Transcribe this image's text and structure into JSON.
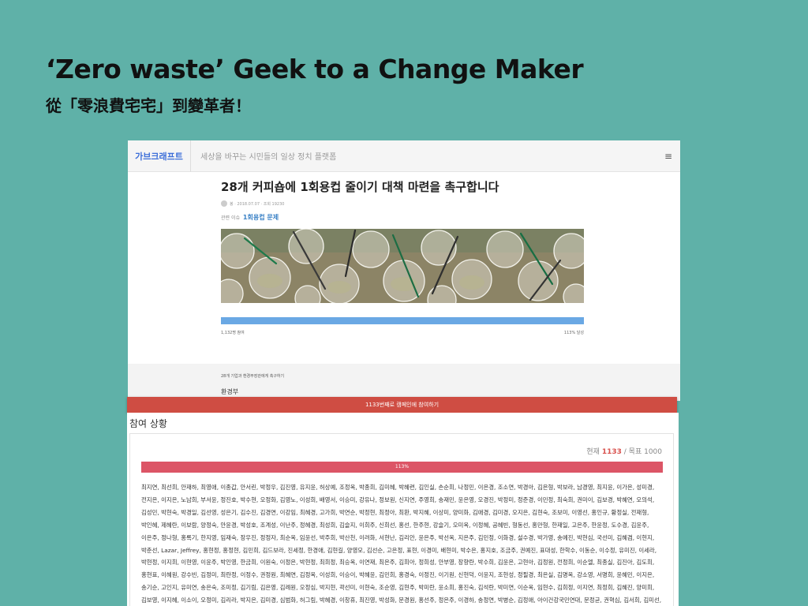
{
  "slide": {
    "title": "‘Zero waste’ Geek to a Change Maker",
    "subtitle": "從「零浪費宅宅」到變革者！"
  },
  "campaign_page": {
    "brand": "가브크래프트",
    "tagline": "세상을 바꾸는 시민들의 일상 정치 플랫폼",
    "menu_icon": "hamburger-icon",
    "post_title": "28개 커피숍에 1회용컵 줄이기 대책 마련을 촉구합니다",
    "meta": "봉 · 2018.07.07 · 조회 19230",
    "issue_label": "관련 이슈",
    "issue_link": "1회용컵 문제",
    "photo_alt": "plastic cups",
    "progress_fraction": 1.0,
    "participants_text": "1,132명 참여",
    "achievement_text": "113% 달성",
    "target_label": "28개 기업과 환경부장관에게 촉구하기",
    "target_name": "환경부"
  },
  "cta": {
    "label": "1133번째로 캠페인에 참여하기"
  },
  "participation": {
    "heading": "참여 상황",
    "current_label": "현재",
    "current_value": "1133",
    "goal_text": "/ 목표 1000",
    "percent_label": "113%",
    "percent_fraction": 1.0,
    "names": "최지연, 최선희, 안재하, 최영애, 이종갑, 안서린, 박정우, 김진영, 유지윤, 허상예, 조정옥, 박종희, 김미혜, 박혜련, 김인실, 손순희, 나정민, 이은경, 조소연, 박경아, 김은형, 박보라, 남경영, 최지윤, 이가은, 성미경, 전지은, 이지은, 노남희, 부서윤, 정진호, 박수현, 오정화, 김영노, 이성희, 배영서, 이승미, 강유나, 정보원, 신지연, 주영희, 송재민, 윤은영, 오경진, 박정미, 정준경, 이민정, 최숙희, 권미이, 김보경, 박혜연, 오의석, 김성민, 박현숙, 박경일, 김선영, 성은기, 김수진, 김경연, 이강임, 최혜경, 고가희, 박연순, 박정현, 최정아, 최환, 박지혜, 이상미, 양미화, 김애경, 김미경, 오지은, 김현숙, 조보미, 이영선, 홍인규, 황정실, 전재형, 박인혜, 제혜란, 이보람, 양정숙, 안윤경, 박성호, 조계성, 이난주, 정혜경, 최성희, 김슬지, 이희주, 신희선, 홍선, 한주현, 강슬기, 오미옥, 이정혜, 공혜빈, 형동선, 홍만형, 한재일, 고은주, 한윤정, 도수경, 김윤주, 이은주, 정나형, 홍록기, 한지영, 임재숙, 장우진, 정정자, 최순옥, 임윤선, 박주희, 박산천, 이려화, 서현난, 김리안, 윤은주, 박선옥, 지은주, 김민정, 이화경, 설수경, 박가영, 송예진, 박현심, 국선미, 김혜겸, 이현지, 박춘선, Lazar, Jeffrey, 홍현정, 홍정현, 김민희, 김드보라, 진세정, 한경애, 김현길, 양영모, 김선순, 고은정, 표현, 이경미, 배현미, 박수은, 홍지호, 조금주, 권예진, 표대성, 한학수, 이동순, 이수정, 유미진, 이세라, 박현정, 이지희, 이현영, 이윤주, 박인영, 한금희, 이원숙, 이정은, 박현정, 최희정, 최승옥, 이연재, 최은주, 김희아, 정희성, 안부영, 장향란, 박수희, 김윤은, 고현아, 김정원, 전정희, 이순엘, 최종실, 김진아, 김도희, 홍현표, 이혜원, 강수빈, 김정미, 최란정, 이정수, 권정원, 최혜연, 김정옥, 이성희, 이승이, 박혜윤, 김민희, 홍경숙, 이정진, 이기원, 신현덕, 이윤지, 조현성, 정필경, 최은실, 김명옥, 강소영, 서명희, 윤혜민, 이지은, 송기순, 고인지, 유미연, 송은숙, 조미정, 김기림, 김은영, 김례원, 오정심, 박지현, 곽선미, 이현숙, 조순영, 김현주, 박미란, 윤소희, 홍진숙, 김석란, 박미연, 이순옥, 임현수, 김희정, 이지연, 최정희, 김혜진, 양미희, 김보영, 이지혜, 이소이, 오정미, 김리라, 박지은, 김미경, 심범화, 허그림, 박혜경, 이창휴, 최진영, 박성화, 문경원, 홍선주, 정은주, 이경하, 송정연, 박병순, 김정애, 아이건강국민연대, 문정균, 권혁심, 김서희, 김미선, 유혜수, 김선미, 안수경, 황현실, 조현정, 최혜정, 최혜정, 이성란, 이남지, 김미소, 신영선, 전윤환, 윤상현, 유지숙, 이민주, 조진숙, 홍윤의, 이기옥, 옥희진, 성영남, 임성운, 김현주, 조은아, 구기선, 구명진, 이미진, 박경한, 이관숙"
  }
}
